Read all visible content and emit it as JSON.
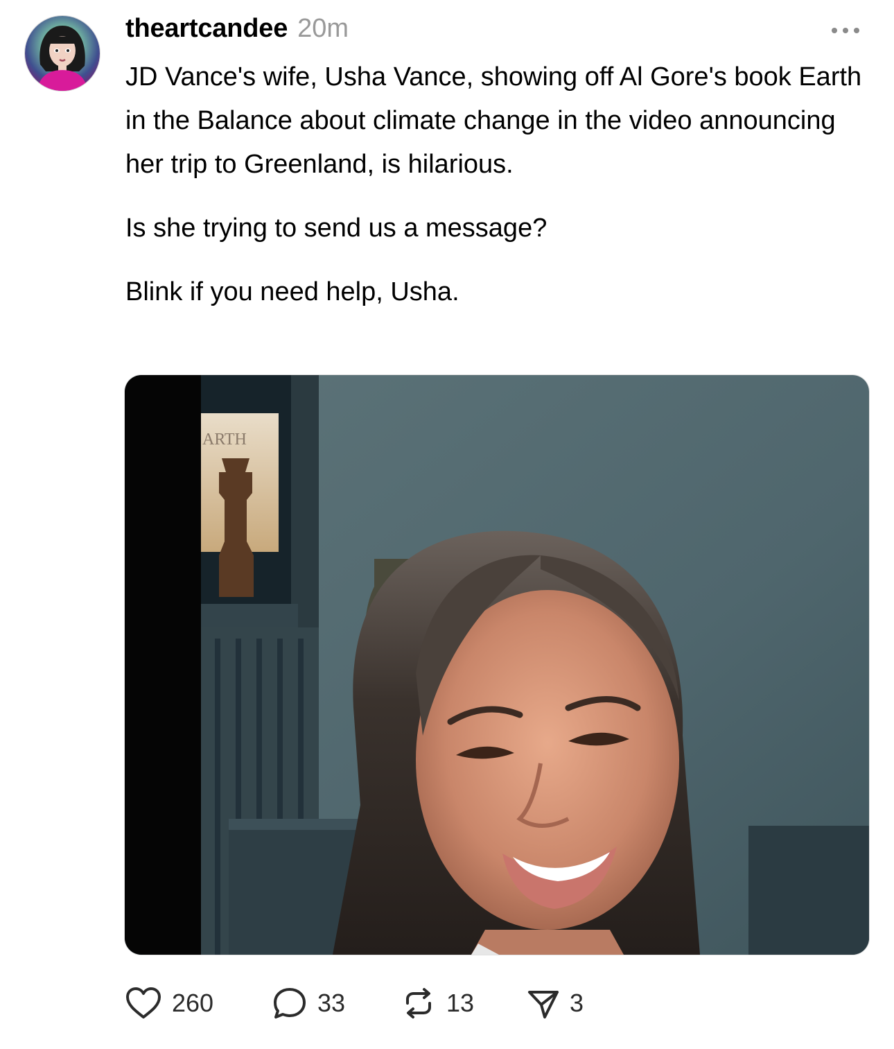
{
  "post": {
    "username": "theartcandee",
    "timestamp": "20m",
    "avatar_icon": "avatar-illustration",
    "more_icon": "more-dots-icon",
    "paragraphs": [
      "JD Vance's wife, Usha Vance, showing off Al Gore's book Earth in the Balance about climate change in the video announcing her trip to Greenland, is hilarious.",
      "Is she trying to send us a message?",
      "Blink if you need help, Usha."
    ],
    "media": {
      "kind": "video-still",
      "book_cover_text": "ARTH"
    }
  },
  "actions": {
    "likes": "260",
    "replies": "33",
    "reposts": "13",
    "shares": "3",
    "icons": [
      "heart-icon",
      "reply-bubble-icon",
      "repost-icon",
      "share-icon"
    ]
  },
  "colors": {
    "text": "#000000",
    "muted": "#999999",
    "count": "#2b2b2b",
    "avatar_accent": "#d81b9a"
  }
}
